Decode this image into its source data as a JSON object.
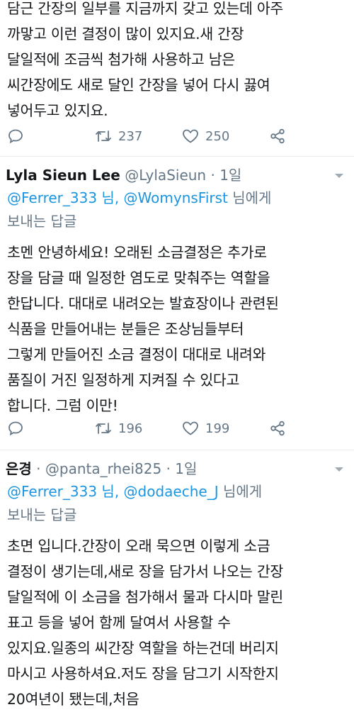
{
  "tweets": [
    {
      "body_lines": [
        "담근 간장의 일부를 지금까지 갖고 있는데 아주",
        "까맣고 이런 결정이 많이 있지요.새 간장",
        "달일적에 조금씩 첨가해 사용하고 남은",
        "씨간장에도 새로 달인 간장을 넣어 다시 끓여",
        "넣어두고 있지요."
      ],
      "actions": {
        "retweets": "237",
        "likes": "250"
      }
    },
    {
      "author_name": "Lyla Sieun Lee",
      "handle": "@LylaSieun",
      "separator": "·",
      "time": "1일",
      "reply_mentions": [
        "@Ferrer_333 님,",
        "@WomynsFirst"
      ],
      "reply_suffix": "님에게",
      "reply_line2": "보내는 답글",
      "body_lines": [
        "초멘 안녕하세요! 오래된 소금결정은 추가로",
        "장을 담글 때 일정한 염도로 맞춰주는 역할을",
        "한답니다. 대대로 내려오는 발효장이나 관련된",
        "식품을 만들어내는 분들은 조상님들부터",
        "그렇게 만들어진 소금 결정이 대대로 내려와",
        "품질이 거진 일정하게 지켜질 수 있다고",
        "합니다. 그럼 이만!"
      ],
      "actions": {
        "retweets": "196",
        "likes": "199"
      }
    },
    {
      "author_name": "은경",
      "handle": "@panta_rhei825",
      "separator": "·",
      "time": "1일",
      "reply_mentions": [
        "@Ferrer_333 님,",
        "@dodaeche_J"
      ],
      "reply_suffix": "님에게",
      "reply_line2": "보내는 답글",
      "body_lines": [
        "초면 입니다.간장이 오래 묵으면 이렇게 소금",
        "결정이 생기는데,새로 장을 담가서 나오는 간장",
        "달일적에 이 소금을 첨가해서 물과 다시마 말린",
        "표고 등을 넣어 함께 달여서 사용할 수",
        "있지요.일종의 씨간장 역할을 하는건데 버리지",
        "마시고 사용하셔요.저도 장을 담그기 시작한지",
        "20여년이 됐는데,처음"
      ]
    }
  ],
  "colors": {
    "mention": "#1b95e0",
    "meta": "#657786",
    "icon": "#657786",
    "divider": "#e6ecf0"
  },
  "icons": [
    "reply-icon",
    "retweet-icon",
    "like-icon",
    "share-icon",
    "caret-down-icon"
  ]
}
